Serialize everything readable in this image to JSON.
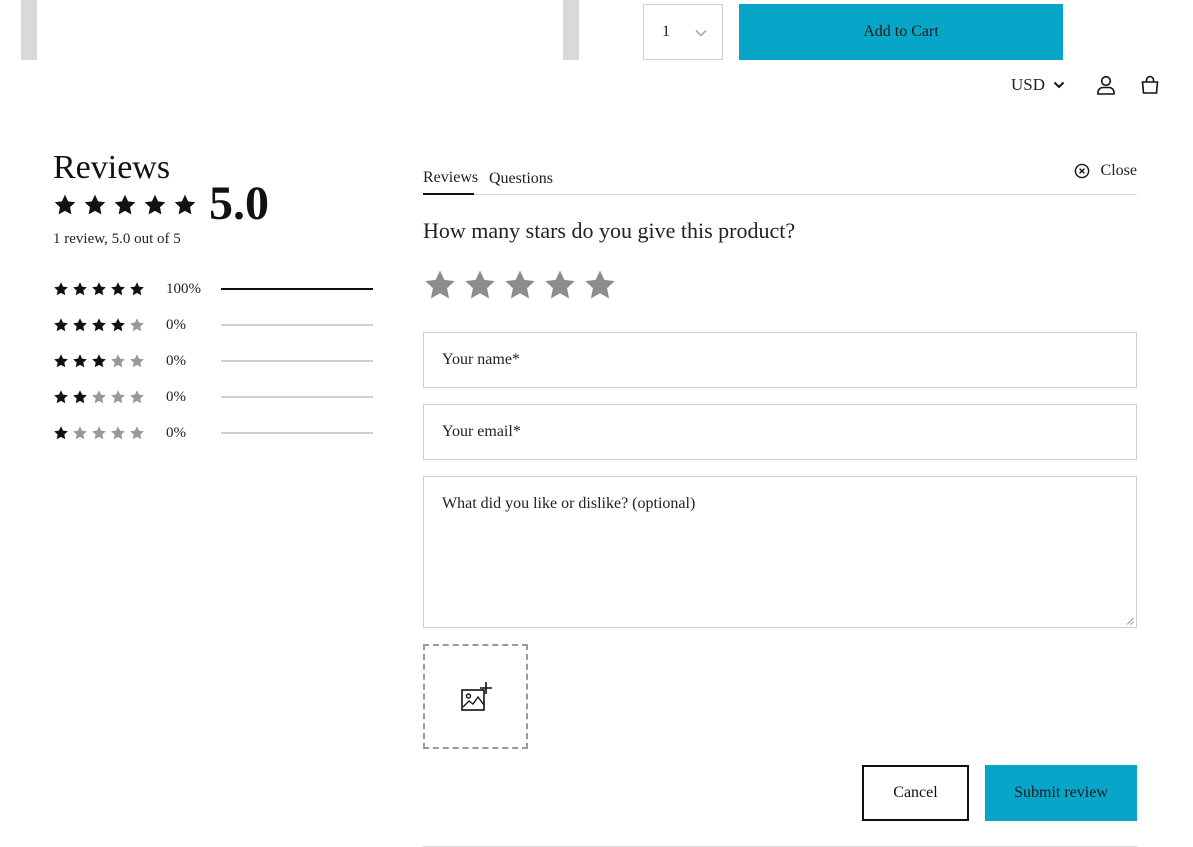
{
  "product": {
    "quantity": "1",
    "add_to_cart_label": "Add to Cart"
  },
  "header": {
    "currency": "USD",
    "icons": [
      "account-icon",
      "cart-icon",
      "chevron-down-icon"
    ]
  },
  "summary": {
    "title": "Reviews",
    "average": "5.0",
    "average_stars": 5,
    "count_text": "1 review, 5.0 out of 5",
    "distribution": [
      {
        "stars": 5,
        "percent_label": "100%",
        "fraction": 1.0
      },
      {
        "stars": 4,
        "percent_label": "0%",
        "fraction": 0
      },
      {
        "stars": 3,
        "percent_label": "0%",
        "fraction": 0
      },
      {
        "stars": 2,
        "percent_label": "0%",
        "fraction": 0
      },
      {
        "stars": 1,
        "percent_label": "0%",
        "fraction": 0
      }
    ]
  },
  "form": {
    "tabs": [
      {
        "label": "Reviews",
        "active": true
      },
      {
        "label": "Questions",
        "active": false
      }
    ],
    "close_label": "Close",
    "question": "How many stars do you give this product?",
    "rating_selected": 0,
    "name_placeholder": "Your name*",
    "email_placeholder": "Your email*",
    "comment_placeholder": "What did you like or dislike? (optional)",
    "upload_icon": "add-image-icon",
    "cancel_label": "Cancel",
    "submit_label": "Submit review"
  },
  "colors": {
    "accent": "#07a6c9",
    "star_filled": "#111111",
    "star_empty": "#999999",
    "rating_star": "#8c8c8c"
  }
}
